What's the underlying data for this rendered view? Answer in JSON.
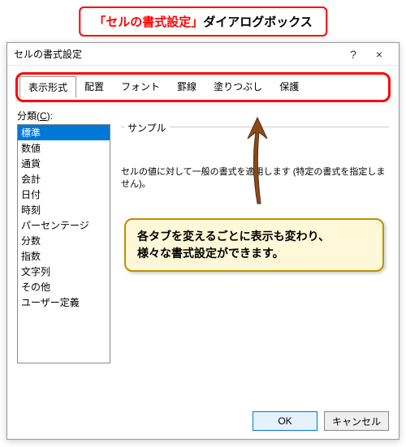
{
  "header": {
    "red_part": "「セルの書式設定」",
    "rest": "ダイアログボックス"
  },
  "dialog": {
    "title": "セルの書式設定",
    "help": "?",
    "close": "×",
    "tabs": [
      {
        "label": "表示形式",
        "selected": true
      },
      {
        "label": "配置"
      },
      {
        "label": "フォント"
      },
      {
        "label": "罫線"
      },
      {
        "label": "塗りつぶし"
      },
      {
        "label": "保護"
      }
    ],
    "category_label_pre": "分類(",
    "category_label_u": "C",
    "category_label_post": "):",
    "categories": [
      {
        "label": "標準",
        "selected": true
      },
      {
        "label": "数値"
      },
      {
        "label": "通貨"
      },
      {
        "label": "会計"
      },
      {
        "label": "日付"
      },
      {
        "label": "時刻"
      },
      {
        "label": "パーセンテージ"
      },
      {
        "label": "分数"
      },
      {
        "label": "指数"
      },
      {
        "label": "文字列"
      },
      {
        "label": "その他"
      },
      {
        "label": "ユーザー定義"
      }
    ],
    "sample_label": "サンプル",
    "description": "セルの値に対して一般の書式を適用します (特定の書式を指定しません)。",
    "ok": "OK",
    "cancel": "キャンセル"
  },
  "annotation": {
    "line1": "各タブを変えるごとに表示も変わり、",
    "line2": "様々な書式設定ができます。"
  }
}
